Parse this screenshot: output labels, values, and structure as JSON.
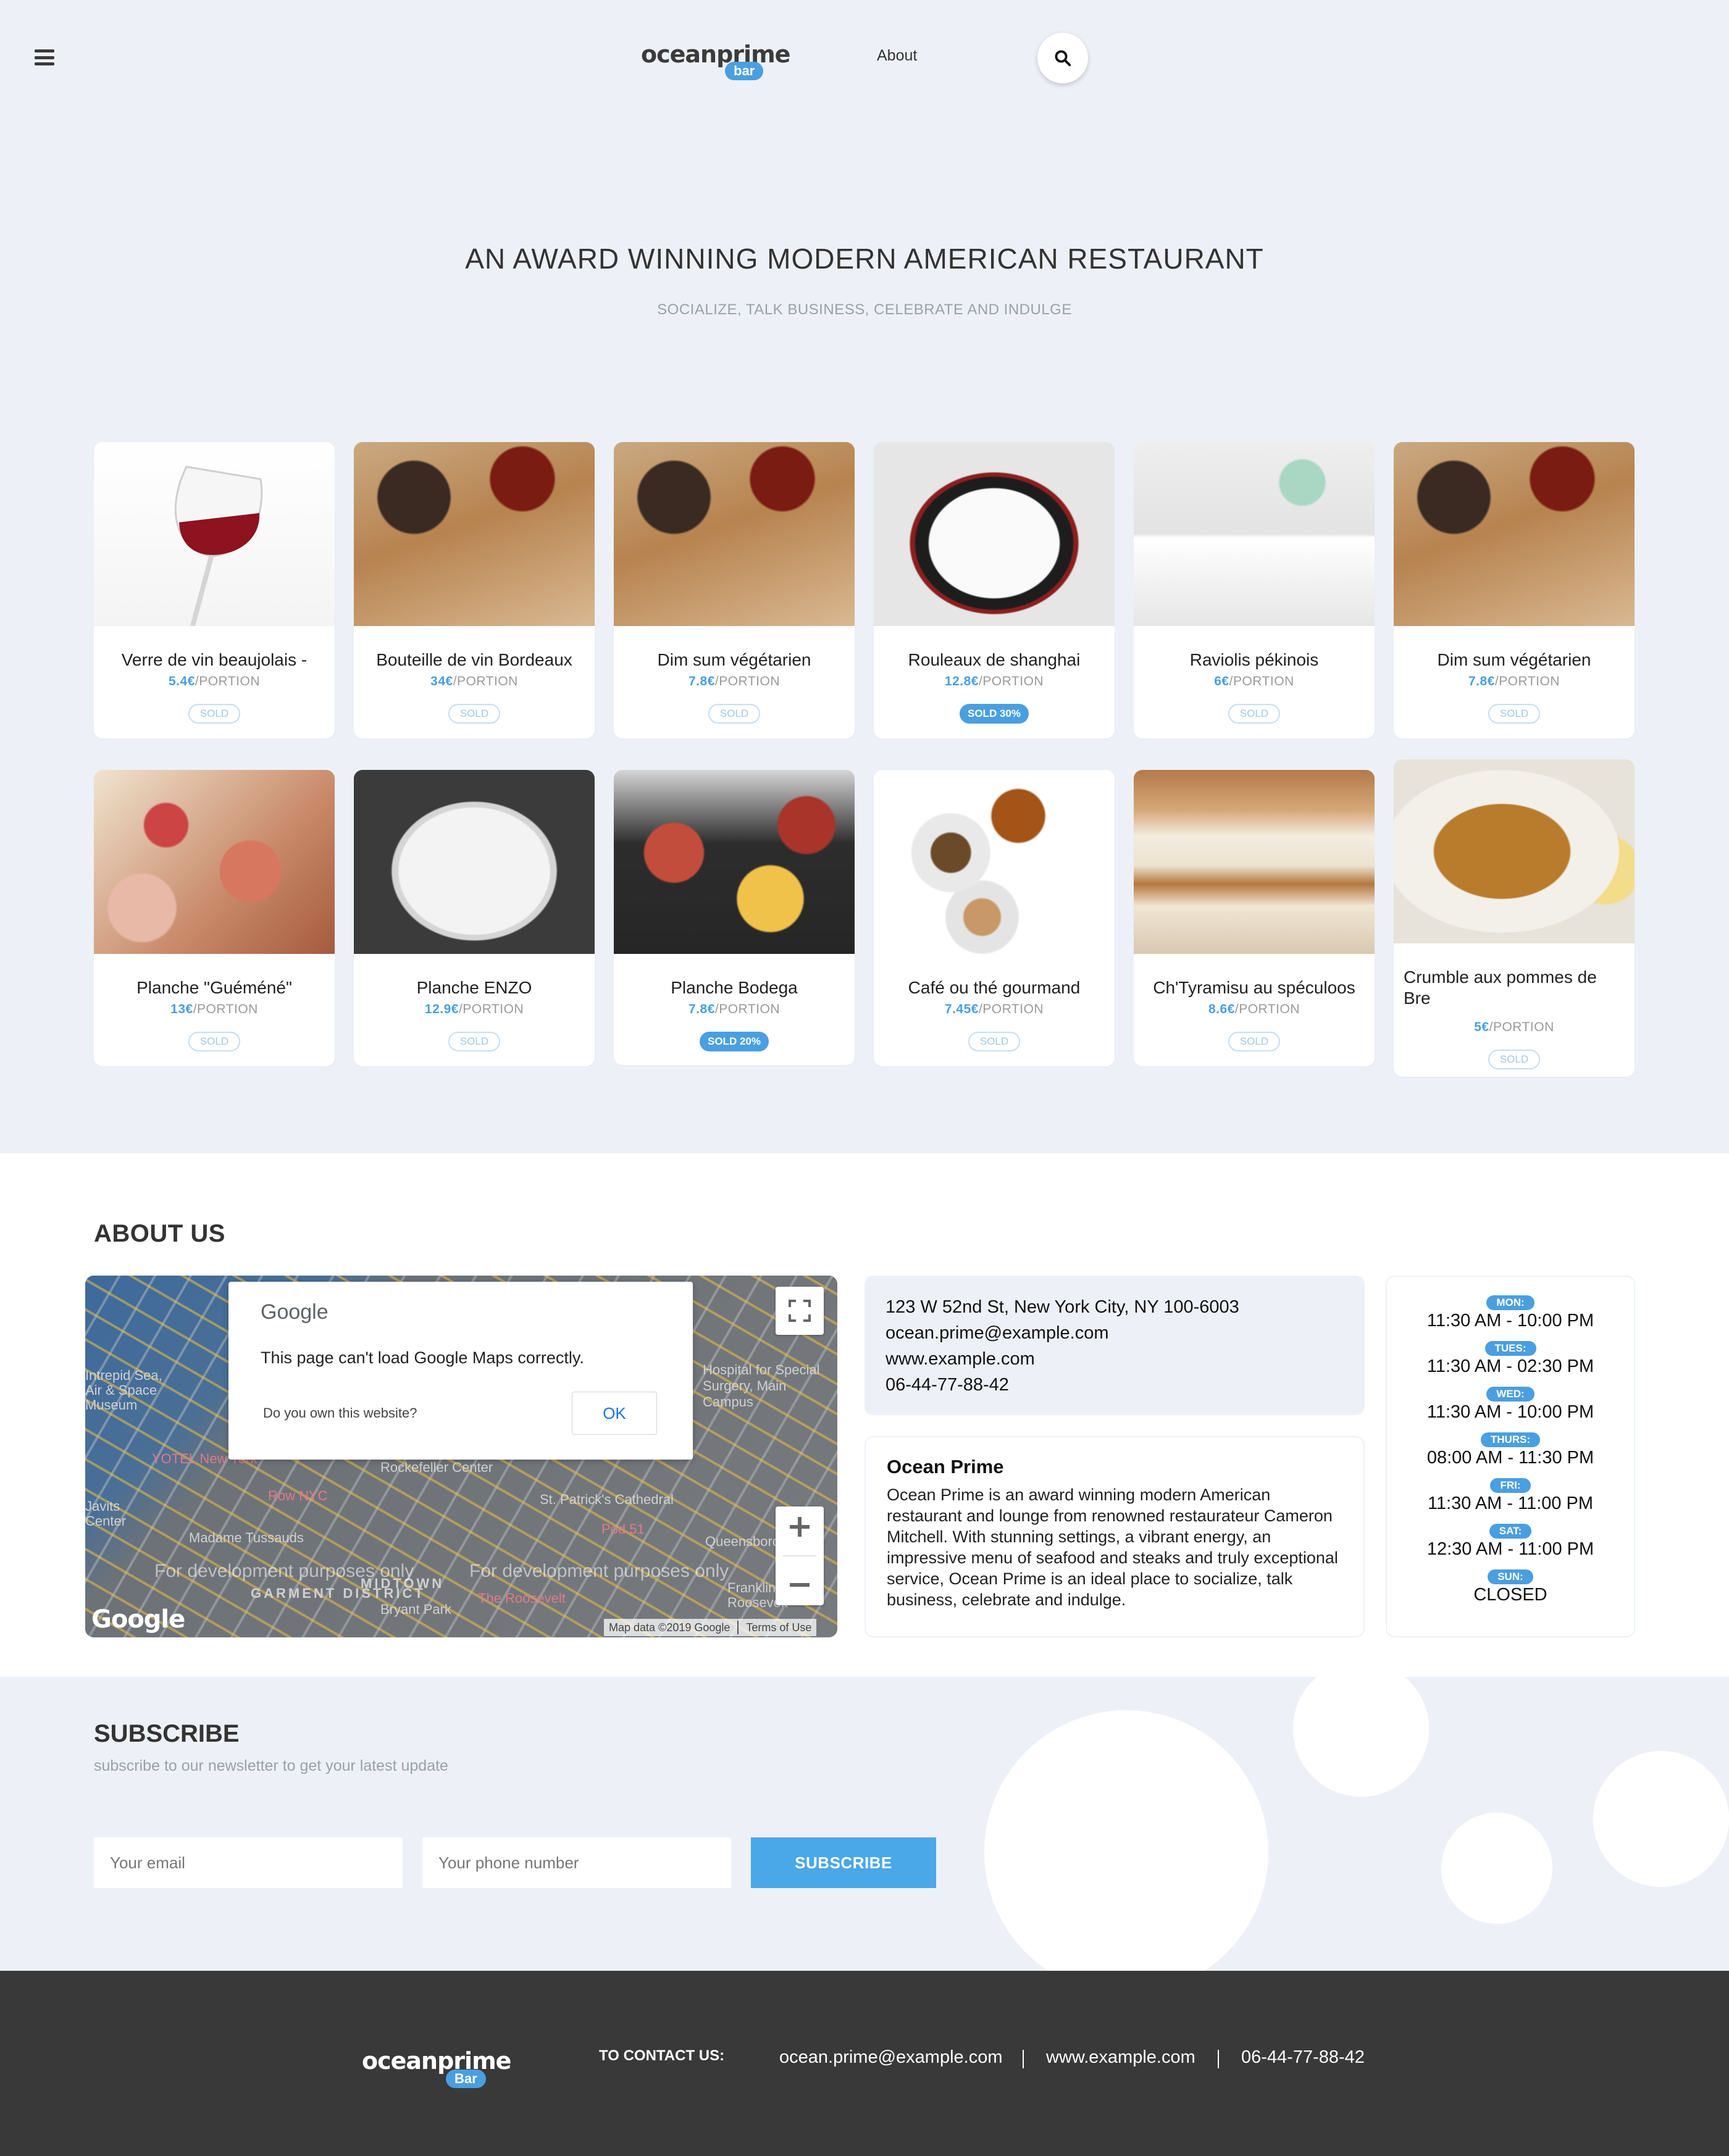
{
  "header": {
    "logo_word": "oceanprime",
    "logo_pill": "bar",
    "nav_about": "About"
  },
  "hero": {
    "title": "AN AWARD WINNING MODERN AMERICAN RESTAURANT",
    "subtitle": "SOCIALIZE, TALK BUSINESS, CELEBRATE AND INDULGE"
  },
  "menu_items": [
    {
      "name": "Verre de vin beaujolais -",
      "price": "5.4€",
      "unit": "/PORTION",
      "badge": "SOLD"
    },
    {
      "name": "Bouteille de vin Bordeaux",
      "price": "34€",
      "unit": "/PORTION",
      "badge": "SOLD"
    },
    {
      "name": "Dim sum végétarien",
      "price": "7.8€",
      "unit": "/PORTION",
      "badge": "SOLD"
    },
    {
      "name": "Rouleaux de shanghai",
      "price": "12.8€",
      "unit": "/PORTION",
      "badge": "SOLD 30%"
    },
    {
      "name": "Raviolis pékinois",
      "price": "6€",
      "unit": "/PORTION",
      "badge": "SOLD"
    },
    {
      "name": "Dim sum végétarien",
      "price": "7.8€",
      "unit": "/PORTION",
      "badge": "SOLD"
    },
    {
      "name": "Planche \"Guéméné\"",
      "price": "13€",
      "unit": "/PORTION",
      "badge": "SOLD"
    },
    {
      "name": "Planche ENZO",
      "price": "12.9€",
      "unit": "/PORTION",
      "badge": "SOLD"
    },
    {
      "name": "Planche Bodega",
      "price": "7.8€",
      "unit": "/PORTION",
      "badge": "SOLD 20%"
    },
    {
      "name": "Café ou thé gourmand",
      "price": "7.45€",
      "unit": "/PORTION",
      "badge": "SOLD"
    },
    {
      "name": "Ch'Tyramisu au spéculoos",
      "price": "8.6€",
      "unit": "/PORTION",
      "badge": "SOLD"
    },
    {
      "name": "Crumble aux pommes de Bre",
      "price": "5€",
      "unit": "/PORTION",
      "badge": "SOLD"
    }
  ],
  "about": {
    "title": "ABOUT US",
    "map": {
      "dialog_brand": "Google",
      "dialog_message": "This page can't load Google Maps correctly.",
      "dialog_question": "Do you own this website?",
      "dialog_ok": "OK",
      "watermark": "For development purposes only",
      "labels": [
        "Rockefeller Center",
        "St. Patrick's Cathedral",
        "Madame Tussauds",
        "Bryant Park",
        "Queensboro",
        "Hospital for Special Surgery, Main Campus",
        "GARMENT DISTRICT",
        "MIDTOWN",
        "Row NYC",
        "The Roosevelt",
        "Pod 51",
        "Franklin Roosevelt",
        "Intrepid Sea, Air & Space Museum",
        "Javits Center",
        "YOTEL New York"
      ],
      "data_credit": "Map data ©2019 Google",
      "terms": "Terms of Use",
      "google_mark": "Google"
    },
    "contact": {
      "address": "123 W 52nd St, New York City, NY 100-6003",
      "email": "ocean.prime@example.com",
      "website": "www.example.com",
      "phone": "06-44-77-88-42"
    },
    "description": {
      "title": "Ocean Prime",
      "text": "Ocean Prime is an award winning modern American restaurant and lounge from renowned restaurateur Cameron Mitchell. With stunning settings, a vibrant energy, an impressive menu of seafood and steaks and truly exceptional service, Ocean Prime is an ideal place to socialize, talk business, celebrate and indulge."
    },
    "hours": [
      {
        "day": "MON:",
        "time": "11:30 AM - 10:00 PM"
      },
      {
        "day": "TUES:",
        "time": "11:30 AM - 02:30 PM"
      },
      {
        "day": "WED:",
        "time": "11:30 AM - 10:00 PM"
      },
      {
        "day": "THURS:",
        "time": "08:00 AM - 11:30 PM"
      },
      {
        "day": "FRI:",
        "time": "11:30 AM - 11:00 PM"
      },
      {
        "day": "SAT:",
        "time": "12:30 AM - 11:00 PM"
      },
      {
        "day": "SUN:",
        "time": "CLOSED"
      }
    ]
  },
  "subscribe": {
    "title": "SUBSCRIBE",
    "description": "subscribe to our newsletter to get your latest update",
    "email_placeholder": "Your email",
    "phone_placeholder": "Your phone number",
    "button": "SUBSCRIBE"
  },
  "footer": {
    "logo_word": "oceanprime",
    "logo_pill": "Bar",
    "contact_label": "TO CONTACT US:",
    "email": "ocean.prime@example.com",
    "website": "www.example.com",
    "phone": "06-44-77-88-42"
  },
  "colors": {
    "accent": "#4a9fe0",
    "page_bg": "#edf1f7",
    "footer_bg": "#393939"
  }
}
